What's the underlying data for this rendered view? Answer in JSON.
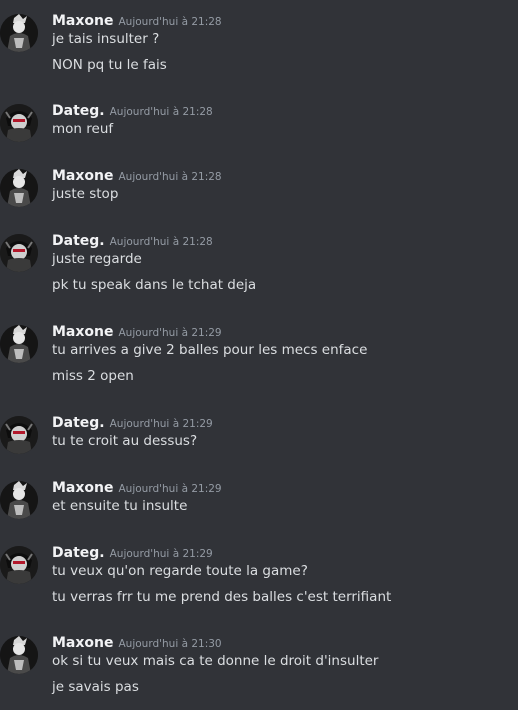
{
  "messages": [
    {
      "author": "Maxone",
      "timestamp": "Aujourd'hui à 21:28",
      "lines": [
        "je tais insulter ?",
        "NON pq tu le fais"
      ]
    },
    {
      "author": "Dateg.",
      "timestamp": "Aujourd'hui à 21:28",
      "lines": [
        "mon reuf"
      ]
    },
    {
      "author": "Maxone",
      "timestamp": "Aujourd'hui à 21:28",
      "lines": [
        "juste stop"
      ]
    },
    {
      "author": "Dateg.",
      "timestamp": "Aujourd'hui à 21:28",
      "lines": [
        "juste regarde",
        "pk tu speak dans le tchat deja"
      ]
    },
    {
      "author": "Maxone",
      "timestamp": "Aujourd'hui à 21:29",
      "lines": [
        "tu arrives a give 2 balles pour les mecs enface",
        "miss 2 open"
      ]
    },
    {
      "author": "Dateg.",
      "timestamp": "Aujourd'hui à 21:29",
      "lines": [
        "tu te croit au dessus?"
      ]
    },
    {
      "author": "Maxone",
      "timestamp": "Aujourd'hui à 21:29",
      "lines": [
        "et ensuite tu insulte"
      ]
    },
    {
      "author": "Dateg.",
      "timestamp": "Aujourd'hui à 21:29",
      "lines": [
        "tu veux qu'on regarde toute la game?",
        "tu verras frr tu me prend des balles c'est terrifiant"
      ]
    },
    {
      "author": "Maxone",
      "timestamp": "Aujourd'hui à 21:30",
      "lines": [
        "ok si tu veux mais ca te donne le droit d'insulter",
        "je savais pas"
      ]
    }
  ]
}
